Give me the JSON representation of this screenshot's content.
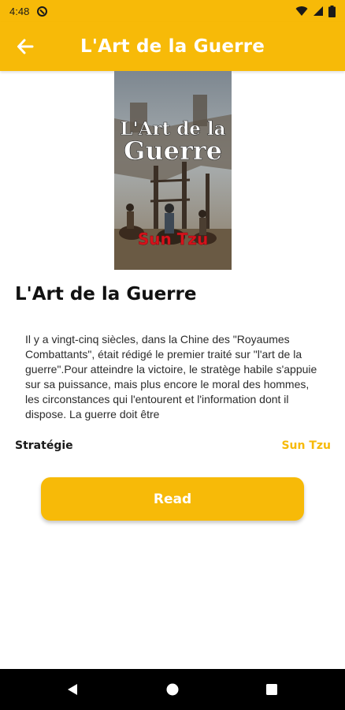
{
  "status_bar": {
    "time": "4:48"
  },
  "app_bar": {
    "title": "L'Art de la Guerre"
  },
  "book": {
    "cover_title_line1": "L'Art de la",
    "cover_title_line2": "Guerre",
    "cover_author": "Sun Tzu",
    "title": "L'Art de la Guerre",
    "description": "Il y a vingt-cinq siècles, dans la Chine des \"Royaumes Combattants\", était rédigé le premier traité sur \"l'art de la guerre\".Pour atteindre la victoire, le stratège habile s'appuie sur sa puissance, mais plus encore le moral des hommes, les circonstances qui l'entourent et l'information dont il dispose. La guerre doit être",
    "category": "Stratégie",
    "author": "Sun Tzu"
  },
  "actions": {
    "read_label": "Read"
  },
  "colors": {
    "accent": "#f7ba08",
    "cover_author": "#d6121b"
  },
  "icons": {
    "back": "arrow-back-icon",
    "dnd": "do-not-disturb-icon",
    "wifi": "wifi-icon",
    "signal": "cell-signal-icon",
    "battery": "battery-icon",
    "nav_back": "triangle-back-icon",
    "nav_home": "circle-home-icon",
    "nav_recents": "square-recents-icon"
  }
}
